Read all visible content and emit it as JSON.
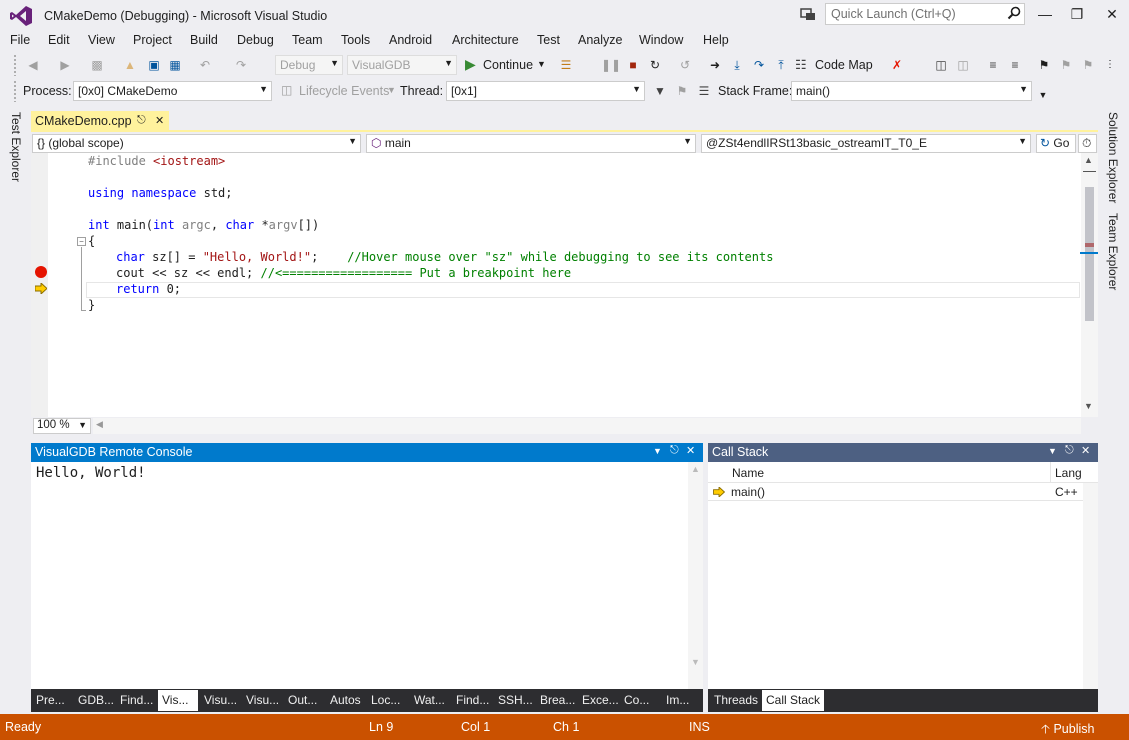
{
  "window": {
    "title": "CMakeDemo (Debugging) - Microsoft Visual Studio",
    "quick_launch_placeholder": "Quick Launch (Ctrl+Q)"
  },
  "menu": [
    "File",
    "Edit",
    "View",
    "Project",
    "Build",
    "Debug",
    "Team",
    "Tools",
    "Android",
    "Architecture",
    "Test",
    "Analyze",
    "Window",
    "Help"
  ],
  "toolbar": {
    "config": "Debug",
    "platform": "VisualGDB",
    "continue_label": "Continue",
    "code_map_label": "Code Map"
  },
  "debug_location": {
    "process_label": "Process:",
    "process_value": "[0x0] CMakeDemo",
    "lifecycle_label": "Lifecycle Events",
    "thread_label": "Thread:",
    "thread_value": "[0x1]",
    "stack_frame_label": "Stack Frame:",
    "stack_frame_value": "main()"
  },
  "side_tabs": {
    "left": "Test Explorer",
    "right_1": "Solution Explorer",
    "right_2": "Team Explorer"
  },
  "editor": {
    "tab_name": "CMakeDemo.cpp",
    "scope": "{} (global scope)",
    "member": "main",
    "symbol": "@ZSt4endlIRSt13basic_ostreamIT_T0_E",
    "go_label": "Go",
    "zoom": "100 %",
    "lines": {
      "include_kw": "#include",
      "include_file": " <iostream>",
      "using": "using",
      "namespace": " namespace",
      "std": " std;",
      "int1": "int",
      "main_sig1": " main(",
      "int2": "int",
      "argc": " argc",
      "comma": ", ",
      "char1": "char",
      "star": " *",
      "argv": "argv",
      "close_sig": "[])",
      "brace_open": "{",
      "char2": "char",
      "sz_decl": " sz[] = ",
      "hello_str": "\"Hello, World!\"",
      "semi": ";    ",
      "comment1": "//Hover mouse over \"sz\" while debugging to see its contents",
      "cout": "cout << sz << endl; ",
      "comment2": "//<================== Put a breakpoint here",
      "return_kw": "return",
      "return_val": " 0;",
      "brace_close": "}"
    }
  },
  "console": {
    "title": "VisualGDB Remote Console",
    "output": "Hello, World!"
  },
  "call_stack": {
    "title": "Call Stack",
    "col_name": "Name",
    "col_lang": "Lang",
    "rows": [
      {
        "name": "main()",
        "lang": "C++"
      }
    ]
  },
  "bottom_tabs": [
    "Pre...",
    "GDB...",
    "Find...",
    "Vis...",
    "Visu...",
    "Visu...",
    "Out...",
    "Autos",
    "Loc...",
    "Wat...",
    "Find...",
    "SSH...",
    "Brea...",
    "Exce...",
    "Co...",
    "Im..."
  ],
  "cs_tabs": [
    "Threads",
    "Call Stack"
  ],
  "status": {
    "ready": "Ready",
    "ln": "Ln 9",
    "col": "Col 1",
    "ch": "Ch 1",
    "ins": "INS",
    "publish": "Publish"
  },
  "colors": {
    "accent": "#007acc",
    "status_bar": "#ca5100",
    "doc_tab": "#fff29d",
    "breakpoint": "#e51400"
  }
}
